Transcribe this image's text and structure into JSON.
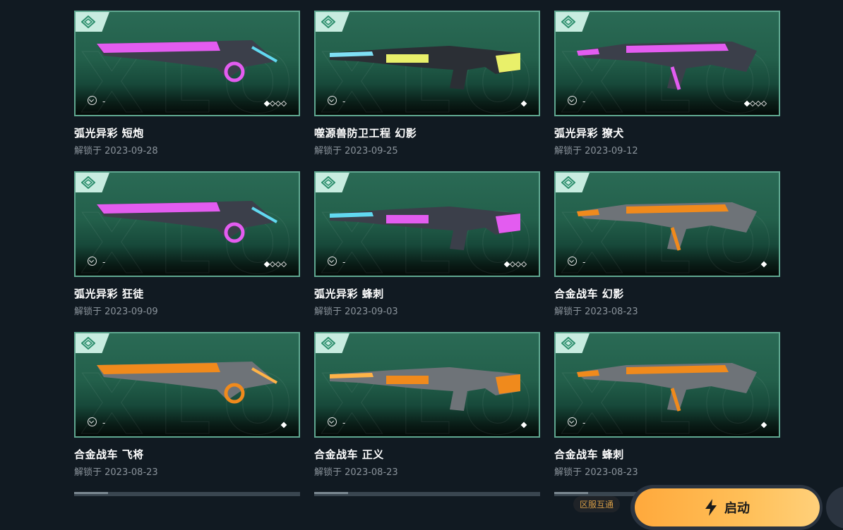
{
  "skins": [
    {
      "name": "弧光异彩 短炮",
      "date": "解锁于 2023-09-28",
      "tier_value": "-",
      "level": 1,
      "level_max": 4,
      "theme": "arc"
    },
    {
      "name": "噬源兽防卫工程 幻影",
      "date": "解锁于 2023-09-25",
      "tier_value": "-",
      "level": 1,
      "level_max": 1,
      "theme": "sentinel"
    },
    {
      "name": "弧光异彩 獠犬",
      "date": "解锁于 2023-09-12",
      "tier_value": "-",
      "level": 1,
      "level_max": 4,
      "theme": "arc"
    },
    {
      "name": "弧光异彩 狂徒",
      "date": "解锁于 2023-09-09",
      "tier_value": "-",
      "level": 1,
      "level_max": 4,
      "theme": "arc"
    },
    {
      "name": "弧光异彩 蜂刺",
      "date": "解锁于 2023-09-03",
      "tier_value": "-",
      "level": 1,
      "level_max": 4,
      "theme": "arc"
    },
    {
      "name": "合金战车 幻影",
      "date": "解锁于 2023-08-23",
      "tier_value": "-",
      "level": 1,
      "level_max": 1,
      "theme": "alloy"
    },
    {
      "name": "合金战车 飞将",
      "date": "解锁于 2023-08-23",
      "tier_value": "-",
      "level": 1,
      "level_max": 1,
      "theme": "alloy"
    },
    {
      "name": "合金战车 正义",
      "date": "解锁于 2023-08-23",
      "tier_value": "-",
      "level": 1,
      "level_max": 1,
      "theme": "alloy"
    },
    {
      "name": "合金战车 蜂刺",
      "date": "解锁于 2023-08-23",
      "tier_value": "-",
      "level": 1,
      "level_max": 1,
      "theme": "alloy"
    }
  ],
  "watermark_text": "XLOI",
  "bottom_bar": {
    "region_badge": "区服互通",
    "launch_label": "启动",
    "launch_icon": "lightning-icon"
  },
  "colors": {
    "page_bg": "#111a22",
    "card_border": "#5fa790",
    "card_top": "#2a6a55",
    "launch_orange": "#ffa93c",
    "region_text": "#d29a45"
  }
}
